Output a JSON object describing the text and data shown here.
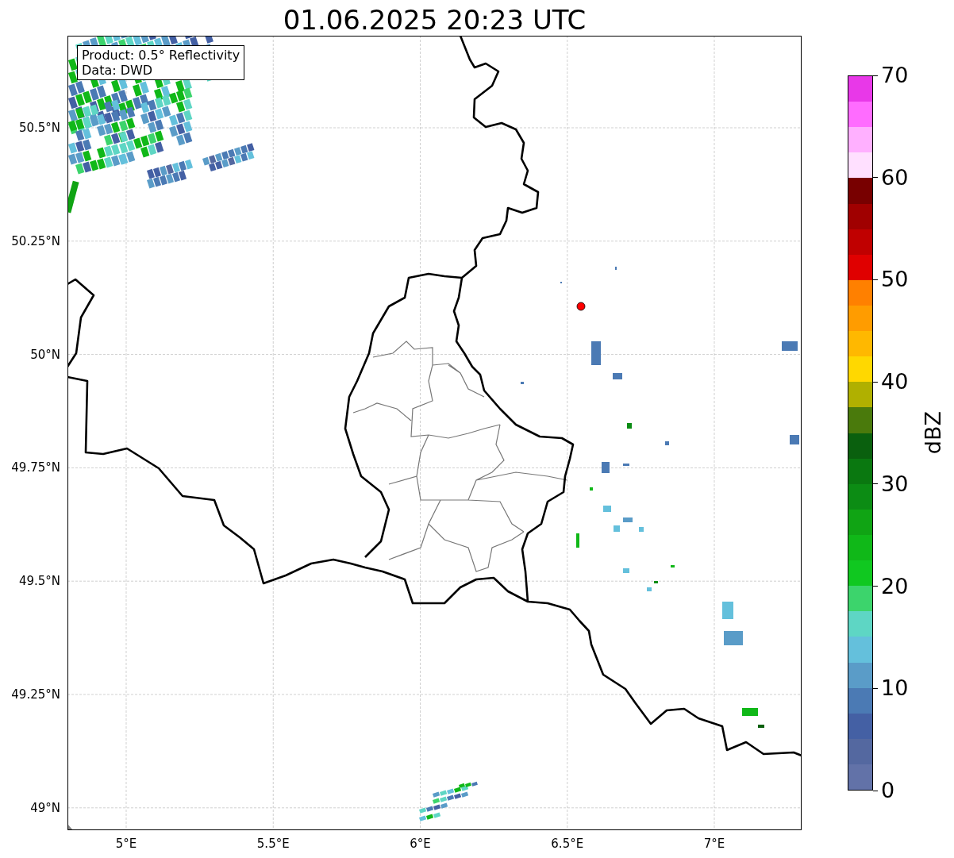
{
  "title": "01.06.2025 20:23 UTC",
  "map": {
    "info_box": [
      "Product: 0.5° Reflectivity",
      "Data: DWD"
    ],
    "lat_labels": [
      "50.5°N",
      "50.25°N",
      "50°N",
      "49.75°N",
      "49.5°N",
      "49.25°N",
      "49°N"
    ],
    "lon_labels": [
      "5°E",
      "5.5°E",
      "6°E",
      "6.5°E",
      "7°E"
    ]
  },
  "colorbar": {
    "label": "dBZ",
    "ticks": [
      "70",
      "60",
      "50",
      "40",
      "30",
      "20",
      "10",
      "0"
    ],
    "bins": [
      {
        "color": "#e838e8"
      },
      {
        "color": "#ff6cff"
      },
      {
        "color": "#ffb0ff"
      },
      {
        "color": "#ffe0ff"
      },
      {
        "color": "#780000"
      },
      {
        "color": "#a00000"
      },
      {
        "color": "#c00000"
      },
      {
        "color": "#e00000"
      },
      {
        "color": "#ff8000"
      },
      {
        "color": "#ff9c00"
      },
      {
        "color": "#ffb800"
      },
      {
        "color": "#ffd800"
      },
      {
        "color": "#b0b000"
      },
      {
        "color": "#4a7a0c"
      },
      {
        "color": "#0a600e"
      },
      {
        "color": "#0a7810"
      },
      {
        "color": "#0c8c14"
      },
      {
        "color": "#10a414"
      },
      {
        "color": "#10b818"
      },
      {
        "color": "#10c820"
      },
      {
        "color": "#3cd46c"
      },
      {
        "color": "#5ed6c4"
      },
      {
        "color": "#64c0dc"
      },
      {
        "color": "#5a9cc8"
      },
      {
        "color": "#4b7ab4"
      },
      {
        "color": "#4460a4"
      },
      {
        "color": "#5468a0"
      },
      {
        "color": "#6272a8"
      }
    ]
  }
}
